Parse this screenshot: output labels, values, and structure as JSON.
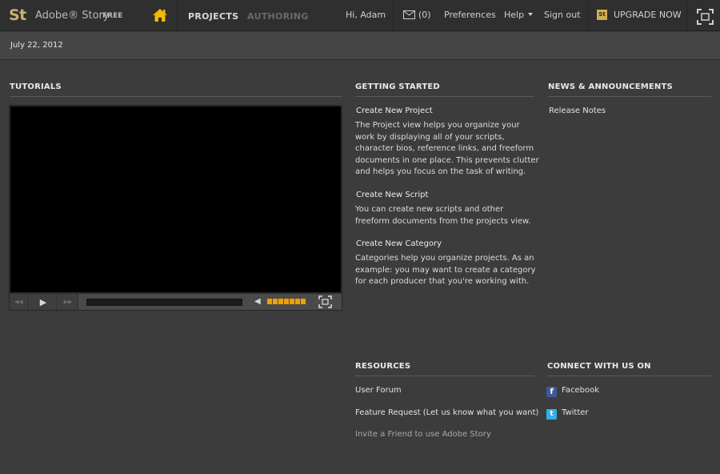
{
  "app": {
    "logo": "St",
    "name": "Adobe® Story",
    "edition": "FREE"
  },
  "nav": {
    "projects": "PROJECTS",
    "authoring": "AUTHORING"
  },
  "user": {
    "greeting": "Hi, Adam",
    "mail_count": "(0)",
    "preferences": "Preferences",
    "help": "Help",
    "sign_out": "Sign out",
    "upgrade_badge": "St",
    "upgrade": "UPGRADE NOW"
  },
  "date": "July 22, 2012",
  "tutorials": {
    "heading": "TUTORIALS"
  },
  "getting_started": {
    "heading": "GETTING STARTED",
    "items": [
      {
        "title": "Create New Project",
        "lines": [
          "The Project view helps you organize your",
          "work by displaying all of your scripts,",
          "character bios, reference links, and freeform",
          "documents in one place. This prevents clutter",
          "and helps you focus on the task of writing."
        ]
      },
      {
        "title": "Create New Script",
        "lines": [
          "You can create new scripts and other",
          "freeform documents from the projects view."
        ]
      },
      {
        "title": "Create New Category",
        "lines": [
          "Categories help you organize projects. As an",
          "example: you may want to create a category",
          "for each producer that you're working with."
        ]
      }
    ]
  },
  "news": {
    "heading": "NEWS & ANNOUNCEMENTS",
    "release_notes": "Release Notes"
  },
  "resources": {
    "heading": "RESOURCES",
    "links": [
      "User Forum",
      "Feature Request (Let us know what you want)",
      "Invite a Friend to use Adobe Story"
    ]
  },
  "connect": {
    "heading": "CONNECT WITH US ON",
    "facebook": "Facebook",
    "twitter": "Twitter",
    "facebook_icon": "f",
    "twitter_icon": "t"
  },
  "colors": {
    "accent_gold": "#cdb06e",
    "home_icon": "#f2b705",
    "volume_orange": "#f0a000",
    "background": "#3c3c3c"
  },
  "icons": [
    "home-icon",
    "mail-icon",
    "fullscreen-icon",
    "play-icon",
    "volume-icon",
    "facebook-icon",
    "twitter-icon"
  ],
  "video": {
    "volume_level": 1.0
  }
}
